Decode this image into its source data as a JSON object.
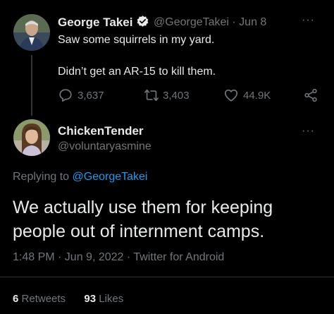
{
  "parent_tweet": {
    "author_name": "George Takei",
    "handle_date": "@GeorgeTakei · Jun 8",
    "text_line1": "Saw some squirrels in my yard.",
    "text_line2": "Didn’t get an AR-15 to kill them.",
    "replies": "3,637",
    "retweets": "3,403",
    "likes": "44.9K",
    "more": "···"
  },
  "reply_tweet": {
    "author_name": "ChickenTender",
    "handle": "@voluntaryasmine",
    "replying_prefix": "Replying to",
    "replying_mention": "@GeorgeTakei",
    "text": "We actually use them for keeping people out of internment camps.",
    "meta": "1:48 PM · Jun 9, 2022 · Twitter for Android",
    "retweets_count": "6",
    "retweets_label": "Retweets",
    "likes_count": "93",
    "likes_label": "Likes",
    "more": "···"
  },
  "icons": {
    "verified": "verified-badge-icon",
    "reply": "reply-icon",
    "retweet": "retweet-icon",
    "like": "heart-icon",
    "share": "share-icon",
    "more": "more-icon"
  },
  "colors": {
    "background": "#000000",
    "text_primary": "#e7e9ea",
    "text_secondary": "#71767b",
    "accent": "#1d9bf0",
    "divider": "#2f3336"
  }
}
